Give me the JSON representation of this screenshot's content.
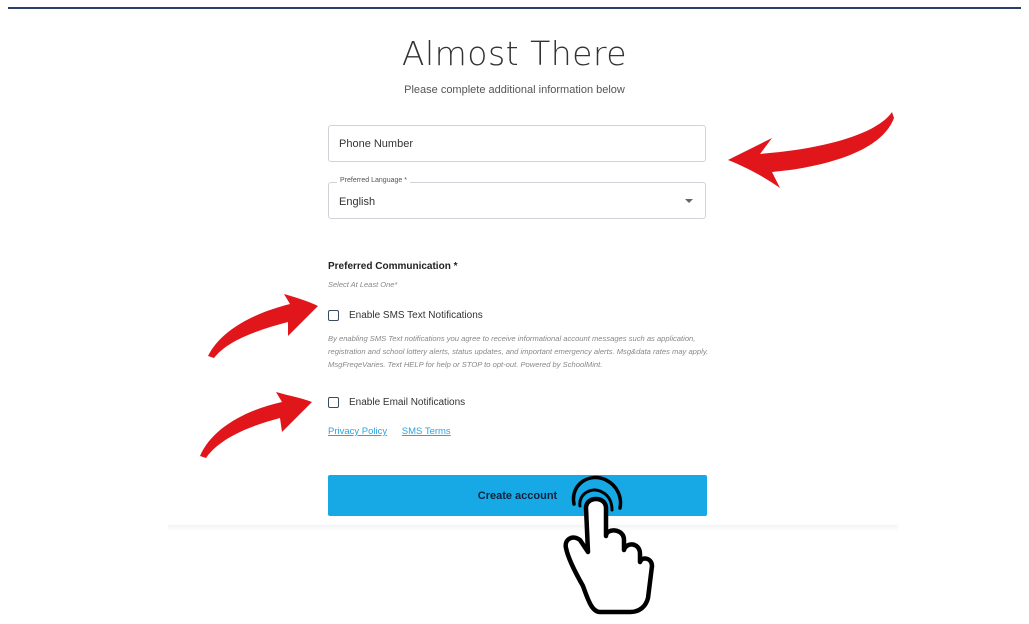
{
  "page": {
    "title": "Almost There",
    "subtitle": "Please complete additional information below"
  },
  "form": {
    "phone": {
      "placeholder": "Phone Number",
      "value": ""
    },
    "language": {
      "label": "Preferred Language *",
      "value": "English"
    },
    "communication": {
      "title": "Preferred Communication *",
      "hint": "Select At Least One*",
      "sms_label": "Enable SMS Text Notifications",
      "sms_checked": false,
      "disclaimer": "By enabling SMS Text notifications you agree to receive informational account messages such as application, registration and school lottery alerts, status updates, and important emergency alerts. Msg&data rates may apply. MsgFreqeVaries. Text HELP for help or STOP to opt-out. Powered by SchoolMint.",
      "email_label": "Enable Email Notifications",
      "email_checked": false
    },
    "links": {
      "privacy": "Privacy Policy",
      "sms_terms": "SMS Terms"
    },
    "submit_label": "Create account"
  },
  "colors": {
    "accent": "#17a9e6",
    "link": "#2ea3df",
    "annotation": "#e0161b",
    "top_rule": "#2c3e6b"
  },
  "annotations": [
    "arrow-right-to-phone",
    "arrow-to-sms-checkbox",
    "arrow-to-email-checkbox",
    "pointing-hand-icon"
  ]
}
